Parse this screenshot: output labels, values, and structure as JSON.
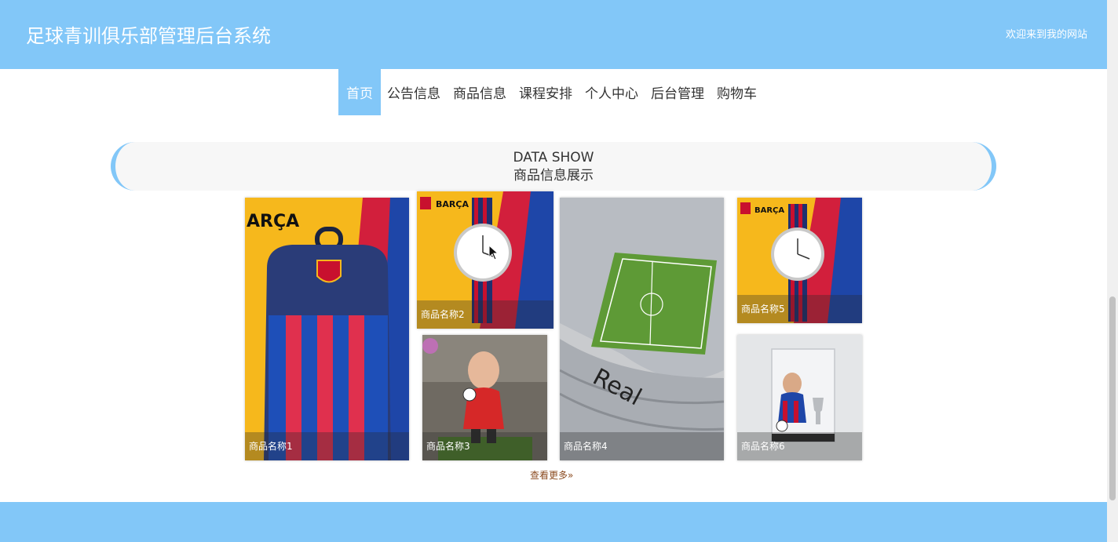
{
  "header": {
    "site_title": "足球青训俱乐部管理后台系统",
    "welcome_text": "欢迎来到我的网站"
  },
  "nav": {
    "items": [
      "首页",
      "公告信息",
      "商品信息",
      "课程安排",
      "个人中心",
      "后台管理",
      "购物车"
    ],
    "active_index": 0
  },
  "section": {
    "title_en": "DATA SHOW",
    "title_cn": "商品信息展示"
  },
  "products": [
    {
      "name": "商品名称1",
      "image": "barca-backpack"
    },
    {
      "name": "商品名称2",
      "image": "barca-watch"
    },
    {
      "name": "商品名称3",
      "image": "player-figurine-red-hoodie"
    },
    {
      "name": "商品名称4",
      "image": "stadium-model"
    },
    {
      "name": "商品名称5",
      "image": "barca-watch"
    },
    {
      "name": "商品名称6",
      "image": "player-figurine-case"
    }
  ],
  "more_link": "查看更多»",
  "colors": {
    "brand": "#82c7f8",
    "barca_yellow": "#f6b81c",
    "barca_blue": "#1e46a8",
    "barca_red": "#d21f3c"
  }
}
